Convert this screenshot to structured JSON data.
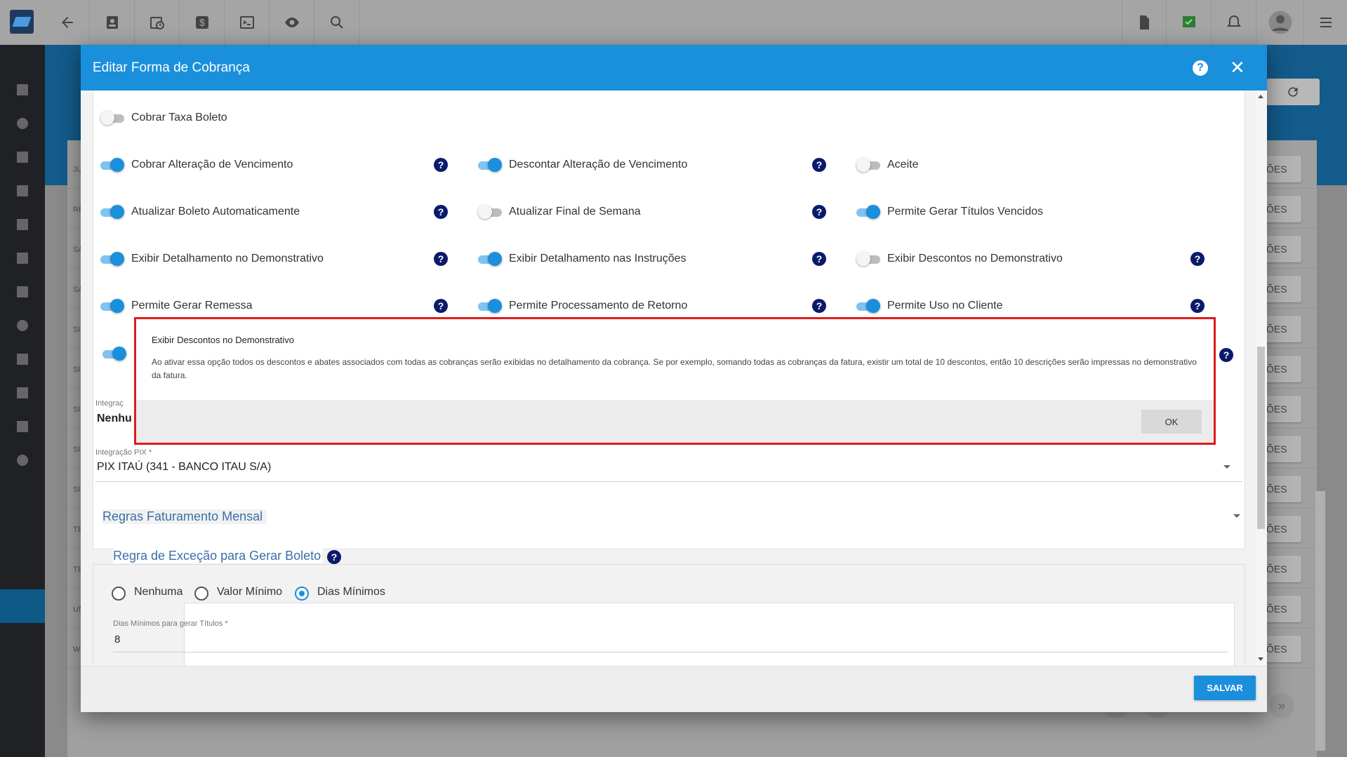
{
  "modal": {
    "title": "Editar Forma de Cobrança",
    "save_label": "SALVAR"
  },
  "toggles": [
    {
      "label": "Cobrar Taxa Boleto",
      "on": false,
      "help": false
    },
    {
      "label": "Cobrar Alteração de Vencimento",
      "on": true,
      "help": true
    },
    {
      "label": "Descontar Alteração de Vencimento",
      "on": true,
      "help": true
    },
    {
      "label": "Aceite",
      "on": false,
      "help": false
    },
    {
      "label": "Atualizar Boleto Automaticamente",
      "on": true,
      "help": true
    },
    {
      "label": "Atualizar Final de Semana",
      "on": false,
      "help": true
    },
    {
      "label": "Permite Gerar Títulos Vencidos",
      "on": true,
      "help": false
    },
    {
      "label": "Exibir Detalhamento no Demonstrativo",
      "on": true,
      "help": true
    },
    {
      "label": "Exibir Detalhamento nas Instruções",
      "on": true,
      "help": true
    },
    {
      "label": "Exibir Descontos no Demonstrativo",
      "on": false,
      "help": true
    },
    {
      "label": "Permite Gerar Remessa",
      "on": true,
      "help": true
    },
    {
      "label": "Permite Processamento de Retorno",
      "on": true,
      "help": true
    },
    {
      "label": "Permite Uso no Cliente",
      "on": true,
      "help": true
    }
  ],
  "fields": {
    "integracao_partial_label": "Integraç",
    "integracao_partial_value": "Nenhu",
    "pix_label": "Integração PIX *",
    "pix_value": "PIX ITAÚ (341 - BANCO ITAU S/A)",
    "dias_label": "Dias Mínimos para gerar Títulos *",
    "dias_value": "8"
  },
  "sections": {
    "regras": "Regras Faturamento Mensal",
    "excecao": "Regra de Exceção para Gerar Boleto"
  },
  "radios": [
    {
      "label": "Nenhuma",
      "selected": false
    },
    {
      "label": "Valor Mínimo",
      "selected": false
    },
    {
      "label": "Dias Mínimos",
      "selected": true
    }
  ],
  "tooltip": {
    "title": "Exibir Descontos no Demonstrativo",
    "body": "Ao ativar essa opção todos os descontos e abates associados com todas as cobranças serão exibidas no detalhamento da cobrança. Se por exemplo, somando todas as cobranças da fatura, existir um total de 10 descontos, então 10 descrições serão impressas no demonstrativo da fatura.",
    "ok_label": "OK"
  },
  "background": {
    "row_letters": [
      "JU",
      "RE",
      "SA",
      "SA",
      "SI",
      "SI",
      "SI",
      "SI",
      "SI",
      "TE",
      "TE",
      "UN",
      "W"
    ],
    "row_button": "ÕES"
  },
  "icons": {
    "topbar": [
      "back-arrow-icon",
      "contacts-icon",
      "calendar-clock-icon",
      "dollar-icon",
      "terminal-icon",
      "eye-icon",
      "search-icon",
      "pdf-icon",
      "check-icon",
      "bell-icon",
      "avatar-icon",
      "menu-icon"
    ]
  },
  "colors": {
    "header_blue": "#1a8fdb",
    "help_navy": "#0a1a6b",
    "highlight_red": "#e01b1b"
  }
}
